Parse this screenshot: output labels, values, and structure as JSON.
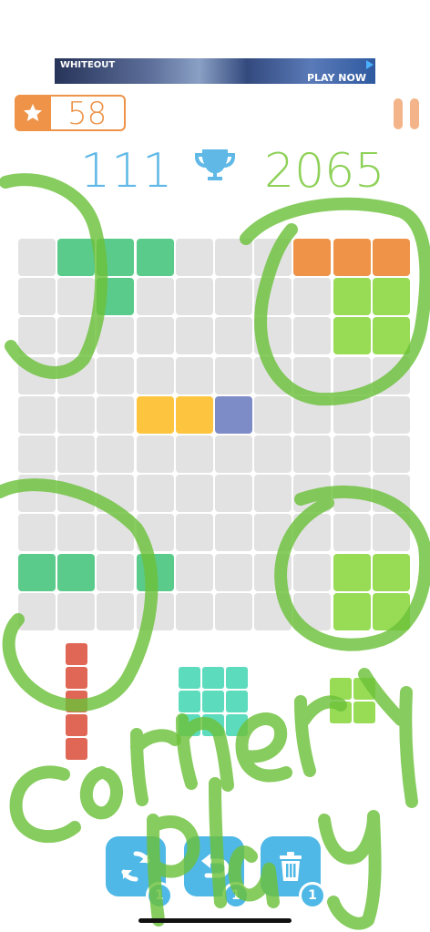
{
  "ad": {
    "brand": "WHITEOUT",
    "cta": "PLAY NOW"
  },
  "stars": {
    "count": "58"
  },
  "score": {
    "current": "111",
    "best": "2065"
  },
  "colors": {
    "orange": "#ee9348",
    "blue": "#5fb8e6",
    "green_text": "#8ed158",
    "empty_cell": "#e2e2e2",
    "tile_green": "#5bcb8b",
    "tile_lime": "#98dc56",
    "tile_orange": "#ee9348",
    "tile_yellow": "#fdc53f",
    "tile_purple": "#7d8bc7",
    "tile_red": "#e06755",
    "tile_teal": "#5ddcbd"
  },
  "board": {
    "size": 10,
    "filled": [
      {
        "r": 0,
        "c": 1,
        "color": "tile_green"
      },
      {
        "r": 0,
        "c": 2,
        "color": "tile_green"
      },
      {
        "r": 0,
        "c": 3,
        "color": "tile_green"
      },
      {
        "r": 1,
        "c": 2,
        "color": "tile_green"
      },
      {
        "r": 0,
        "c": 7,
        "color": "tile_orange"
      },
      {
        "r": 0,
        "c": 8,
        "color": "tile_orange"
      },
      {
        "r": 0,
        "c": 9,
        "color": "tile_orange"
      },
      {
        "r": 1,
        "c": 8,
        "color": "tile_lime"
      },
      {
        "r": 1,
        "c": 9,
        "color": "tile_lime"
      },
      {
        "r": 2,
        "c": 8,
        "color": "tile_lime"
      },
      {
        "r": 2,
        "c": 9,
        "color": "tile_lime"
      },
      {
        "r": 4,
        "c": 3,
        "color": "tile_yellow"
      },
      {
        "r": 4,
        "c": 4,
        "color": "tile_yellow"
      },
      {
        "r": 4,
        "c": 5,
        "color": "tile_purple"
      },
      {
        "r": 8,
        "c": 0,
        "color": "tile_green"
      },
      {
        "r": 8,
        "c": 1,
        "color": "tile_green"
      },
      {
        "r": 8,
        "c": 3,
        "color": "tile_green"
      },
      {
        "r": 8,
        "c": 8,
        "color": "tile_lime"
      },
      {
        "r": 8,
        "c": 9,
        "color": "tile_lime"
      },
      {
        "r": 9,
        "c": 8,
        "color": "tile_lime"
      },
      {
        "r": 9,
        "c": 9,
        "color": "tile_lime"
      }
    ]
  },
  "pieces": [
    {
      "name": "piece-red-vertical-5",
      "color": "tile_red",
      "cells": [
        [
          0,
          0
        ],
        [
          1,
          0
        ],
        [
          2,
          0
        ],
        [
          3,
          0
        ],
        [
          4,
          0
        ]
      ]
    },
    {
      "name": "piece-teal-square-3x3",
      "color": "tile_teal",
      "cells": [
        [
          0,
          0
        ],
        [
          0,
          1
        ],
        [
          0,
          2
        ],
        [
          1,
          0
        ],
        [
          1,
          1
        ],
        [
          1,
          2
        ],
        [
          2,
          0
        ],
        [
          2,
          1
        ],
        [
          2,
          2
        ]
      ]
    },
    {
      "name": "piece-lime-square-2x2",
      "color": "tile_lime",
      "cells": [
        [
          0,
          0
        ],
        [
          0,
          1
        ],
        [
          1,
          0
        ],
        [
          1,
          1
        ]
      ]
    }
  ],
  "powerups": [
    {
      "name": "rotate",
      "icon": "rotate-icon",
      "count": "1"
    },
    {
      "name": "undo",
      "icon": "undo-icon",
      "count": "1"
    },
    {
      "name": "trash",
      "icon": "trash-icon",
      "count": "1"
    }
  ],
  "annotation_text": "Corner play"
}
